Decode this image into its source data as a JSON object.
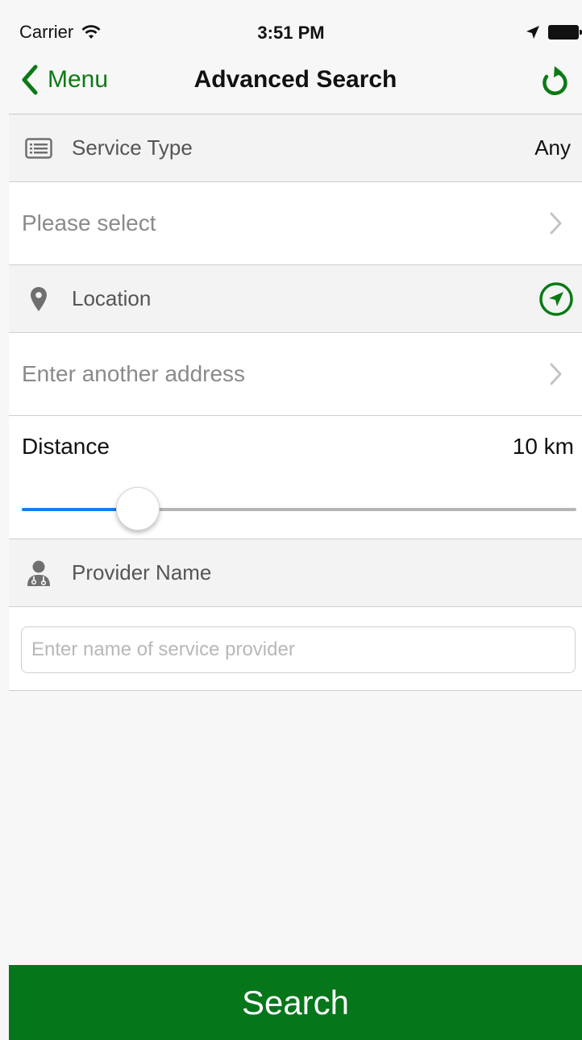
{
  "status_bar": {
    "carrier": "Carrier",
    "time": "3:51 PM"
  },
  "nav": {
    "back_label": "Menu",
    "title": "Advanced Search"
  },
  "service_type": {
    "label": "Service Type",
    "value": "Any",
    "select_placeholder": "Please select"
  },
  "location": {
    "label": "Location",
    "address_placeholder": "Enter another address"
  },
  "distance": {
    "label": "Distance",
    "value_text": "10 km",
    "slider_fraction": 0.21
  },
  "provider": {
    "label": "Provider Name",
    "input_placeholder": "Enter name of service provider",
    "input_value": ""
  },
  "search_button": {
    "label": "Search"
  },
  "colors": {
    "accent_green": "#0b7a15",
    "search_button_bg": "#05761a",
    "slider_fill": "#1a7cf2"
  },
  "icons": {
    "back": "chevron-left-icon",
    "refresh": "refresh-icon",
    "service_type": "list-icon",
    "location": "map-pin-icon",
    "locate": "navigation-arrow-icon",
    "provider": "doctor-icon",
    "disclosure": "chevron-right-icon"
  }
}
